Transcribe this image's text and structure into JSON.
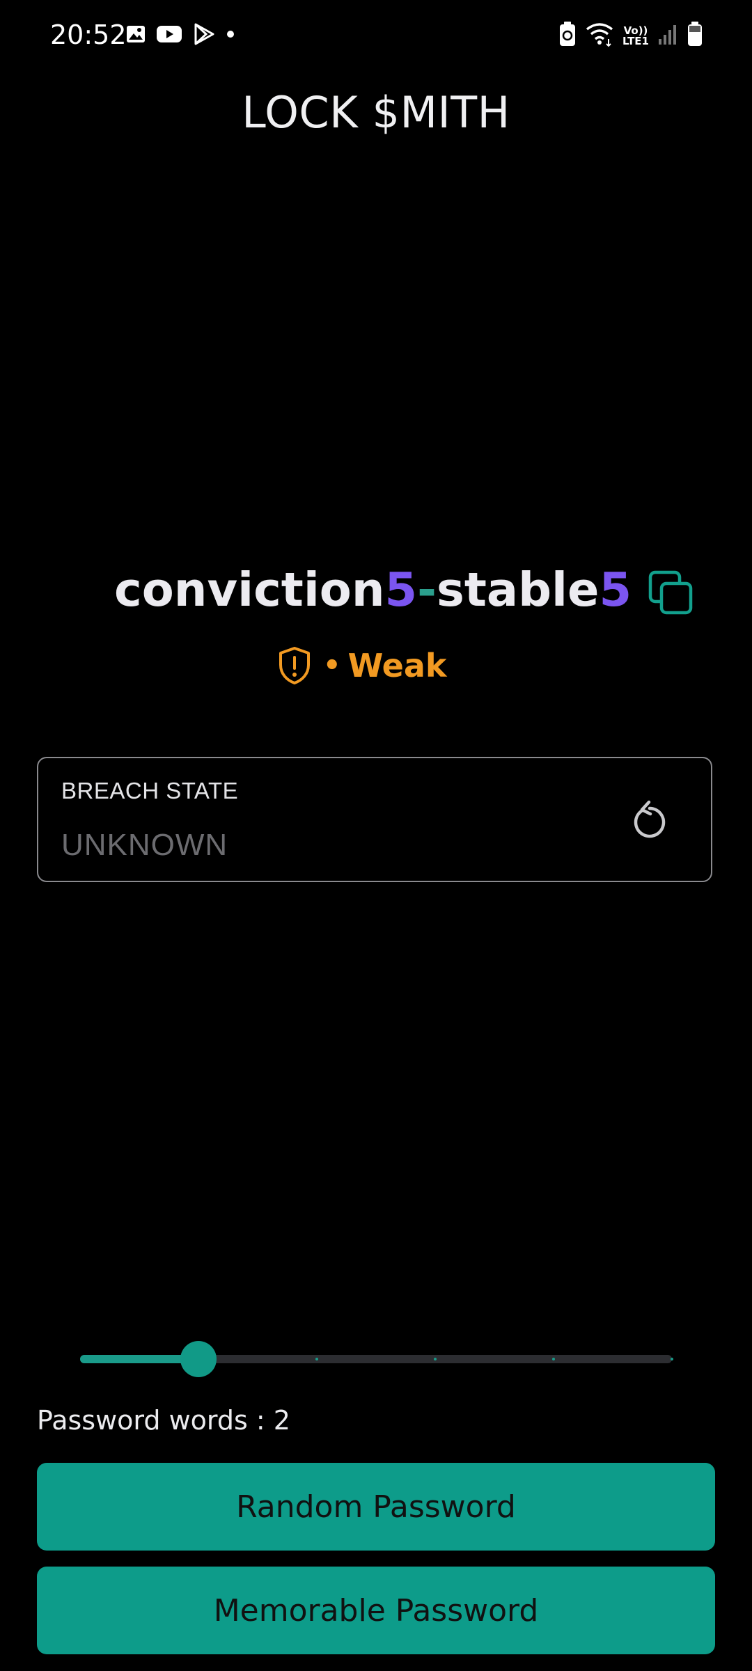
{
  "status_bar": {
    "time": "20:52",
    "left_icons": [
      "image-icon",
      "youtube-icon",
      "play-store-icon",
      "notification-dot-icon"
    ],
    "right_icons": [
      "battery-saver-icon",
      "wifi-icon",
      "volte-lte-icon",
      "signal-icon",
      "battery-icon"
    ],
    "lte_line1": "Vo))",
    "lte_line2": "LTE1"
  },
  "app": {
    "title": "LOCK $MITH"
  },
  "password": {
    "word1": "conviction",
    "digit1": "5",
    "separator": "-",
    "word2": "stable",
    "digit2": "5",
    "copy_icon": "copy-icon"
  },
  "strength": {
    "icon": "shield-alert-icon",
    "dot": "•",
    "label": "Weak",
    "color": "#f29a22"
  },
  "breach": {
    "label": "BREACH STATE",
    "value": "UNKNOWN",
    "refresh_icon": "refresh-icon"
  },
  "slider": {
    "value": 2,
    "min": 1,
    "max": 6
  },
  "words": {
    "label": "Password words : 2"
  },
  "buttons": {
    "random": "Random Password",
    "memorable": "Memorable Password"
  },
  "colors": {
    "accent": "#0d9c8a",
    "digit": "#7b55f0",
    "warning": "#f29a22",
    "background": "#000000"
  }
}
